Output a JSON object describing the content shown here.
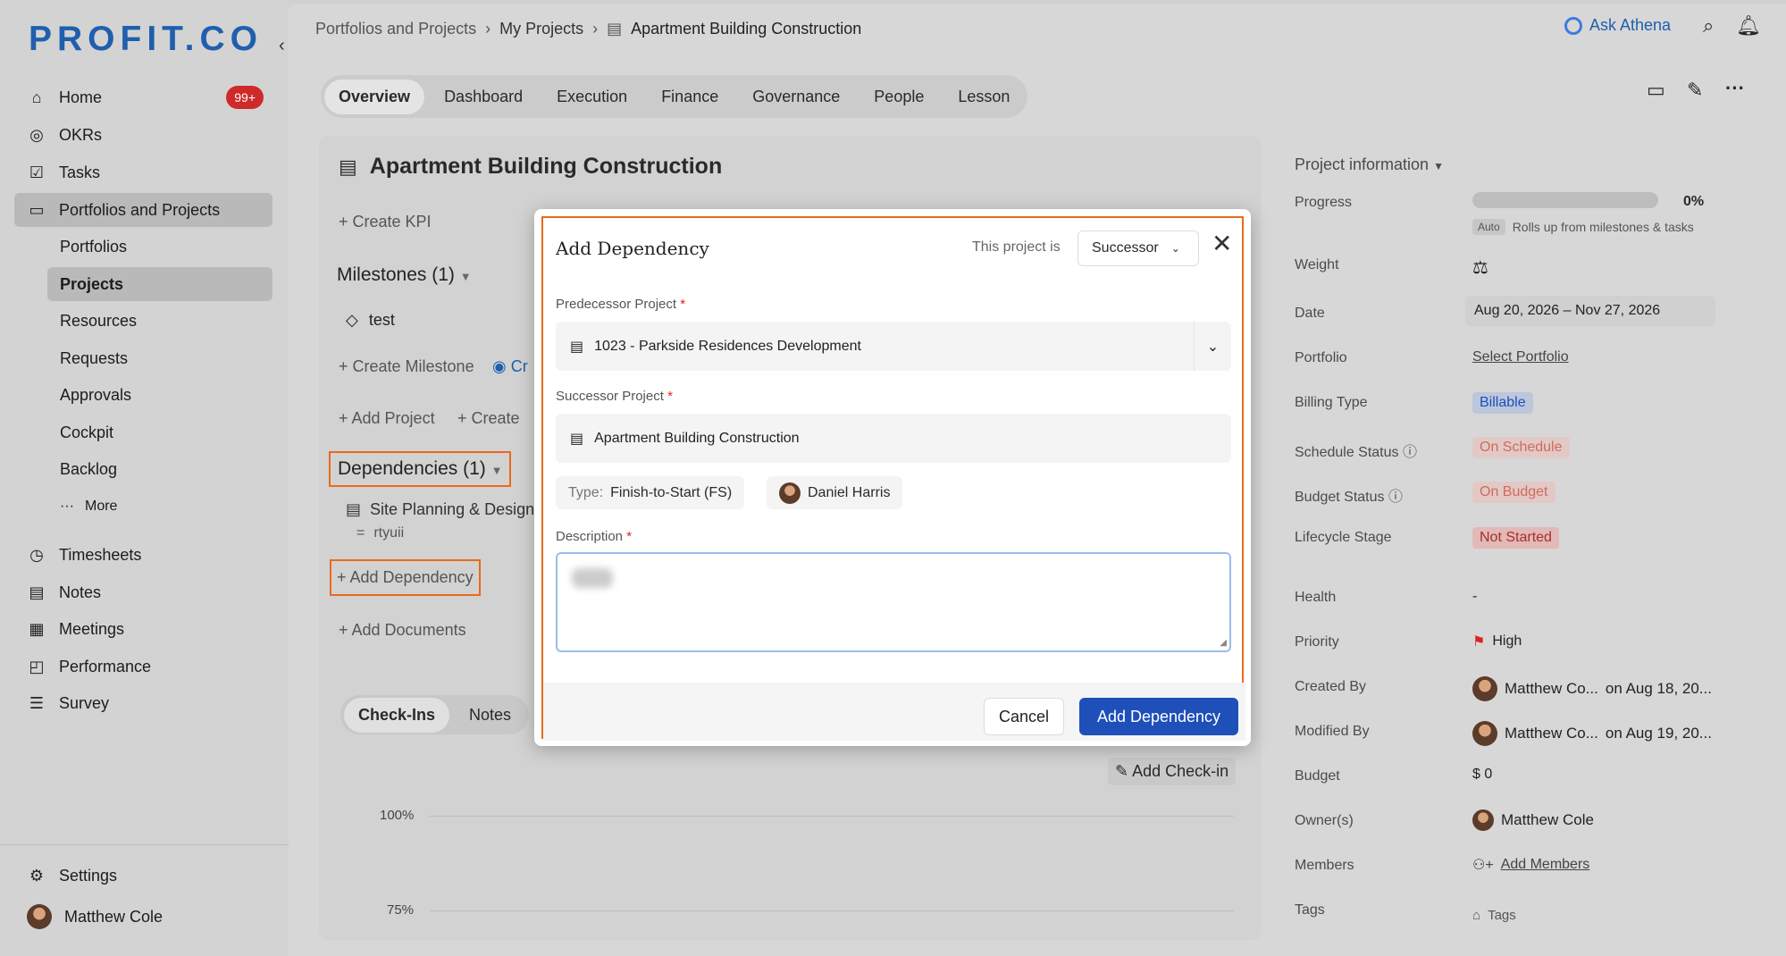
{
  "app": {
    "logo": "PROFIT.CO"
  },
  "sidebar": {
    "items": [
      {
        "label": "Home",
        "badge": "99+",
        "icon": "home-icon"
      },
      {
        "label": "OKRs",
        "icon": "target-icon"
      },
      {
        "label": "Tasks",
        "icon": "checkbox-icon"
      },
      {
        "label": "Portfolios and Projects",
        "icon": "briefcase-icon"
      }
    ],
    "sub_items": [
      "Portfolios",
      "Projects",
      "Resources",
      "Requests",
      "Approvals",
      "Cockpit",
      "Backlog",
      "More"
    ],
    "more_items": [
      {
        "label": "Timesheets",
        "icon": "clock-icon"
      },
      {
        "label": "Notes",
        "icon": "notes-icon"
      },
      {
        "label": "Meetings",
        "icon": "calendar-icon"
      },
      {
        "label": "Performance",
        "icon": "chart-icon"
      },
      {
        "label": "Survey",
        "icon": "survey-icon"
      }
    ],
    "settings": "Settings",
    "user": "Matthew Cole"
  },
  "header": {
    "breadcrumb": [
      "Portfolios and Projects",
      "My Projects",
      "Apartment Building Construction"
    ],
    "ask_athena": "Ask Athena"
  },
  "tabs": [
    "Overview",
    "Dashboard",
    "Execution",
    "Finance",
    "Governance",
    "People",
    "Lesson"
  ],
  "project": {
    "title": "Apartment Building Construction",
    "create_kpi": "+ Create KPI",
    "milestones_title": "Milestones (1)",
    "milestone_item": "test",
    "create_milestone": "+ Create Milestone",
    "create_partial": "Cr",
    "add_project": "+ Add Project",
    "create_partial2": "+ Create",
    "dependencies_title": "Dependencies (1)",
    "dependency_item": "Site Planning & Design",
    "dependency_sub": "rtyuii",
    "add_dependency": "+ Add Dependency",
    "add_documents": "+ Add Documents",
    "checkin_tabs": [
      "Check-Ins",
      "Notes"
    ],
    "add_checkin": "Add Check-in",
    "chart_ticks": [
      "100%",
      "75%"
    ]
  },
  "info": {
    "title": "Project information",
    "progress_label": "Progress",
    "progress_value": "0%",
    "progress_fraction": 0,
    "auto": "Auto",
    "rollup": "Rolls up from milestones & tasks",
    "weight_label": "Weight",
    "date_label": "Date",
    "date_value": "Aug 20, 2026 – Nov 27, 2026",
    "portfolio_label": "Portfolio",
    "portfolio_value": "Select Portfolio",
    "billing_label": "Billing Type",
    "billing_value": "Billable",
    "schedule_label": "Schedule Status",
    "schedule_value": "On Schedule",
    "budget_status_label": "Budget Status",
    "budget_status_value": "On Budget",
    "lifecycle_label": "Lifecycle Stage",
    "lifecycle_value": "Not Started",
    "health_label": "Health",
    "health_value": "-",
    "priority_label": "Priority",
    "priority_value": "High",
    "created_label": "Created By",
    "created_value": "Matthew Co...",
    "created_on": "on Aug 18, 20...",
    "modified_label": "Modified By",
    "modified_value": "Matthew Co...",
    "modified_on": "on Aug 19, 20...",
    "budget_label": "Budget",
    "budget_value": "$ 0",
    "owner_label": "Owner(s)",
    "owner_value": "Matthew Cole",
    "members_label": "Members",
    "members_value": "Add Members",
    "tags_label": "Tags",
    "tags_value": "Tags"
  },
  "modal": {
    "title": "Add Dependency",
    "this_project_is": "This project is",
    "role": "Successor",
    "predecessor_label": "Predecessor Project",
    "predecessor_value": "1023 - Parkside Residences Development",
    "successor_label": "Successor Project",
    "successor_value": "Apartment Building Construction",
    "type_label": "Type:",
    "type_value": "Finish-to-Start (FS)",
    "assignee": "Daniel Harris",
    "description_label": "Description",
    "cancel": "Cancel",
    "submit": "Add Dependency"
  },
  "colors": {
    "brand": "#1f5fae",
    "highlight": "#e96a1c",
    "primary_button": "#1f4fb8"
  }
}
